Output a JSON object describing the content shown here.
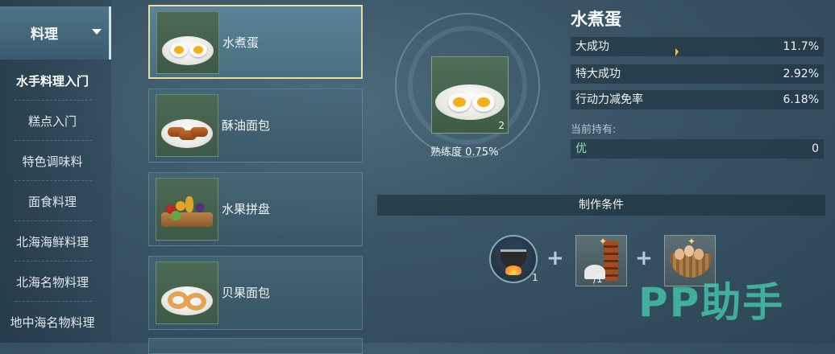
{
  "sidebar": {
    "category_label": "料理",
    "items": [
      {
        "label": "水手料理入门",
        "active": true
      },
      {
        "label": "糕点入门",
        "active": false
      },
      {
        "label": "特色调味料",
        "active": false
      },
      {
        "label": "面食料理",
        "active": false
      },
      {
        "label": "北海海鲜料理",
        "active": false
      },
      {
        "label": "北海名物料理",
        "active": false
      },
      {
        "label": "地中海名物料理",
        "active": false
      }
    ]
  },
  "recipes": [
    {
      "name": "水煮蛋",
      "icon": "boiled-egg-icon",
      "selected": true
    },
    {
      "name": "酥油面包",
      "icon": "butter-bread-icon",
      "selected": false
    },
    {
      "name": "水果拼盘",
      "icon": "fruit-platter-icon",
      "selected": false
    },
    {
      "name": "贝果面包",
      "icon": "bagel-icon",
      "selected": false
    }
  ],
  "detail": {
    "title": "水煮蛋",
    "owned_count": "2",
    "proficiency": "熟练度 0.75%",
    "stats": [
      {
        "label": "大成功",
        "value": "11.7%"
      },
      {
        "label": "特大成功",
        "value": "2.92%"
      },
      {
        "label": "行动力减免率",
        "value": "6.18%"
      }
    ],
    "holding_label": "当前持有:",
    "holding": {
      "label": "优",
      "value": "0"
    }
  },
  "conditions": {
    "title": "制作条件",
    "ingredients": [
      {
        "icon": "cooking-pot-icon",
        "count": "1"
      },
      {
        "icon": "salt-icon",
        "count": "/1"
      },
      {
        "icon": "eggs-basket-icon",
        "count": ""
      }
    ]
  },
  "watermark": "PP助手",
  "colors": {
    "accent_gold": "#e9dca0",
    "holding_green": "#8fe2a8",
    "watermark": "#46d2af"
  }
}
